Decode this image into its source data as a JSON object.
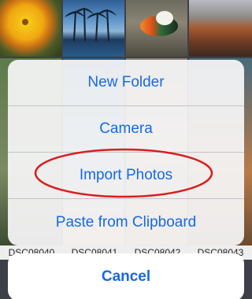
{
  "action_sheet": {
    "options": [
      {
        "label": "New Folder"
      },
      {
        "label": "Camera"
      },
      {
        "label": "Import Photos"
      },
      {
        "label": "Paste from Clipboard"
      }
    ],
    "cancel_label": "Cancel"
  },
  "background_files": [
    "DSC08040",
    "DSC08041",
    "DSC08042",
    "DSC08043"
  ],
  "colors": {
    "accent": "#1669e6",
    "annotation": "#d81e1e"
  }
}
